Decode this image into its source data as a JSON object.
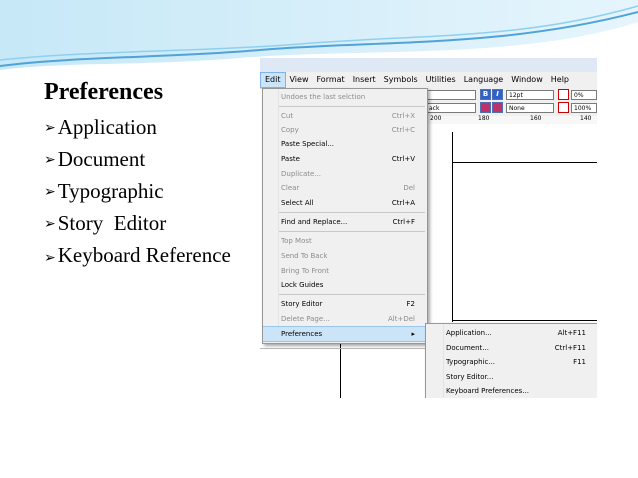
{
  "slide": {
    "title": "Preferences",
    "bullets": [
      "Application",
      "Document",
      "Typographic",
      "Story  Editor",
      "Keyboard Reference"
    ],
    "accent_colors": [
      "#4fa3d8",
      "#8fd0f0",
      "#c6e8f7"
    ]
  },
  "menubar": [
    "Edit",
    "View",
    "Format",
    "Insert",
    "Symbols",
    "Utilities",
    "Language",
    "Window",
    "Help"
  ],
  "toolbar": {
    "font_fragment": "ack",
    "size": "12pt",
    "color": "None",
    "percent_top": "0%",
    "percent_bottom": "100%",
    "bold": "B",
    "italic": "I"
  },
  "ruler_ticks": [
    "200",
    "180",
    "160",
    "140"
  ],
  "edit_menu": [
    {
      "label": "Undoes the last selction",
      "shortcut": "",
      "enabled": false
    },
    {
      "label": "Cut",
      "shortcut": "Ctrl+X",
      "enabled": false
    },
    {
      "label": "Copy",
      "shortcut": "Ctrl+C",
      "enabled": false
    },
    {
      "label": "Paste Special...",
      "shortcut": "",
      "enabled": true
    },
    {
      "label": "Paste",
      "shortcut": "Ctrl+V",
      "enabled": true
    },
    {
      "label": "Duplicate...",
      "shortcut": "",
      "enabled": false
    },
    {
      "label": "Clear",
      "shortcut": "Del",
      "enabled": false
    },
    {
      "label": "Select All",
      "shortcut": "Ctrl+A",
      "enabled": true
    },
    {
      "label": "Find and Replace...",
      "shortcut": "Ctrl+F",
      "enabled": true
    },
    {
      "label": "Top Most",
      "shortcut": "",
      "enabled": false
    },
    {
      "label": "Send To Back",
      "shortcut": "",
      "enabled": false
    },
    {
      "label": "Bring To Front",
      "shortcut": "",
      "enabled": false
    },
    {
      "label": "Lock Guides",
      "shortcut": "",
      "enabled": true
    },
    {
      "label": "Story Editor",
      "shortcut": "F2",
      "enabled": true
    },
    {
      "label": "Delete Page...",
      "shortcut": "Alt+Del",
      "enabled": false
    },
    {
      "label": "Preferences",
      "shortcut": "▸",
      "enabled": true
    }
  ],
  "submenu": [
    {
      "label": "Application...",
      "shortcut": "Alt+F11"
    },
    {
      "label": "Document...",
      "shortcut": "Ctrl+F11"
    },
    {
      "label": "Typographic...",
      "shortcut": "F11"
    },
    {
      "label": "Story Editor...",
      "shortcut": ""
    },
    {
      "label": "Keyboard Preferences...",
      "shortcut": ""
    }
  ]
}
